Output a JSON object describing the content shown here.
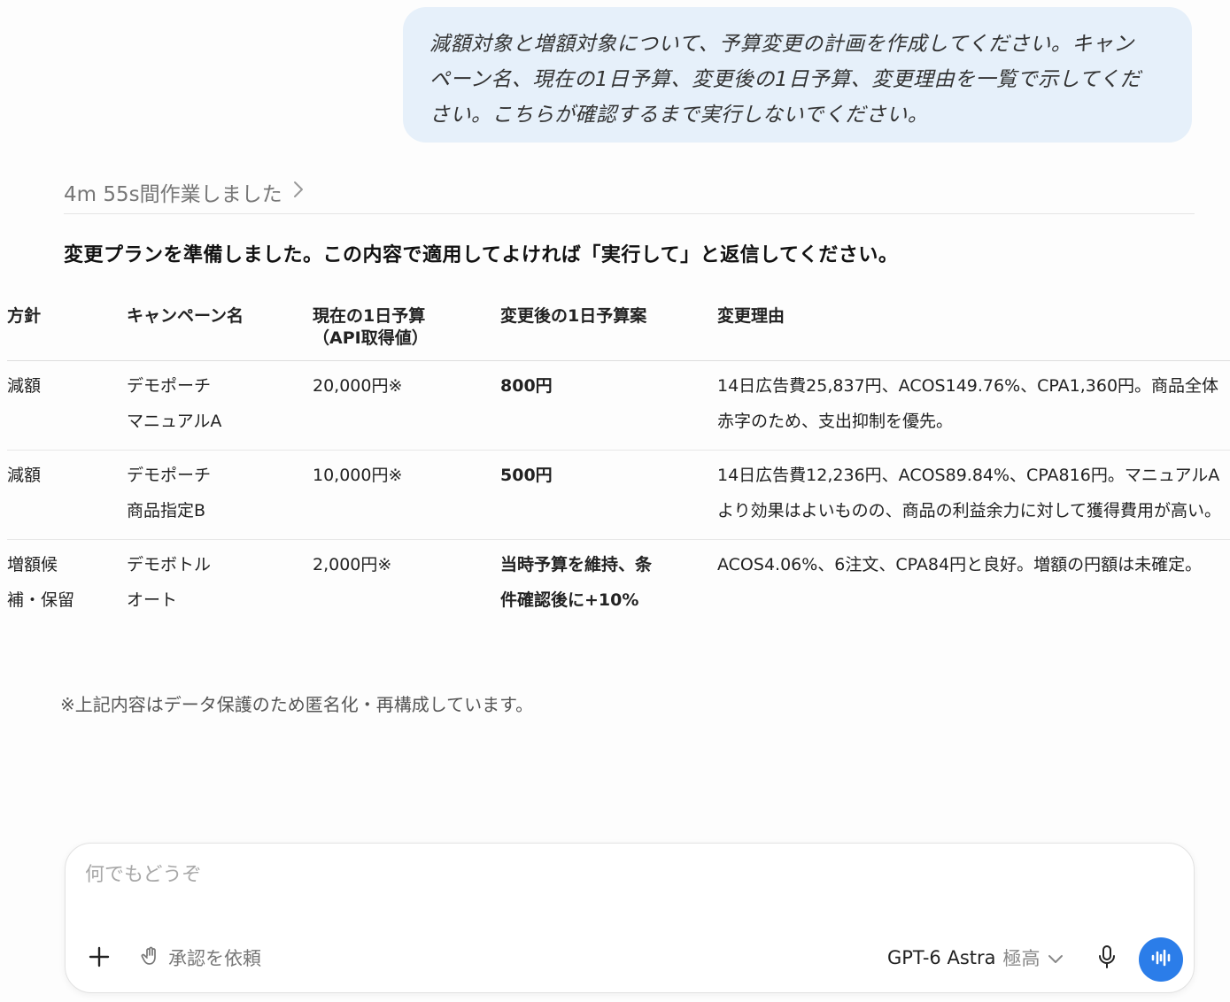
{
  "user_message": {
    "lines": [
      "減額対象と増額対象について、予算変更の計画を作成してください。キャン",
      "ペーン名、現在の1日予算、変更後の1日予算、変更理由を一覧で示してくだ",
      "さい。こちらが確認するまで実行しないでください。"
    ]
  },
  "assistant": {
    "worked_label": "4m 55s間作業しました",
    "lead": "変更プランを準備しました。この内容で適用してよければ「実行して」と返信してください。",
    "table": {
      "headers": [
        "方針",
        "キャンペーン名",
        "現在の1日予算\n（API取得値）",
        "変更後の1日予算案",
        "変更理由"
      ],
      "rows": [
        [
          "減額",
          "デモポーチ\nマニュアルA",
          "20,000円※",
          "800円",
          "14日広告費25,837円、ACOS149.76%、CPA1,360円。商品全体\n赤字のため、支出抑制を優先。"
        ],
        [
          "減額",
          "デモポーチ\n商品指定B",
          "10,000円※",
          "500円",
          "14日広告費12,236円、ACOS89.84%、CPA816円。マニュアルA\nより効果はよいものの、商品の利益余力に対して獲得費用が高い。"
        ],
        [
          "増額候\n補・保留",
          "デモボトル\nオート",
          "2,000円※",
          "当時予算を維持、条\n件確認後に+10%",
          "ACOS4.06%、6注文、CPA84円と良好。増額の円額は未確定。"
        ]
      ]
    },
    "note": "※上記内容はデータ保護のため匿名化・再構成しています。"
  },
  "composer": {
    "placeholder": "何でもどうぞ",
    "approve_label": "承認を依頼",
    "model_name": "GPT-6 Astra",
    "model_tier": "極高"
  },
  "colors": {
    "bubble": "#e6f0fa",
    "accent": "#2b7de9"
  },
  "icons": [
    "chevron-right-icon",
    "plus-icon",
    "hand-icon",
    "chevron-down-icon",
    "microphone-icon",
    "voice-waveform-icon"
  ]
}
